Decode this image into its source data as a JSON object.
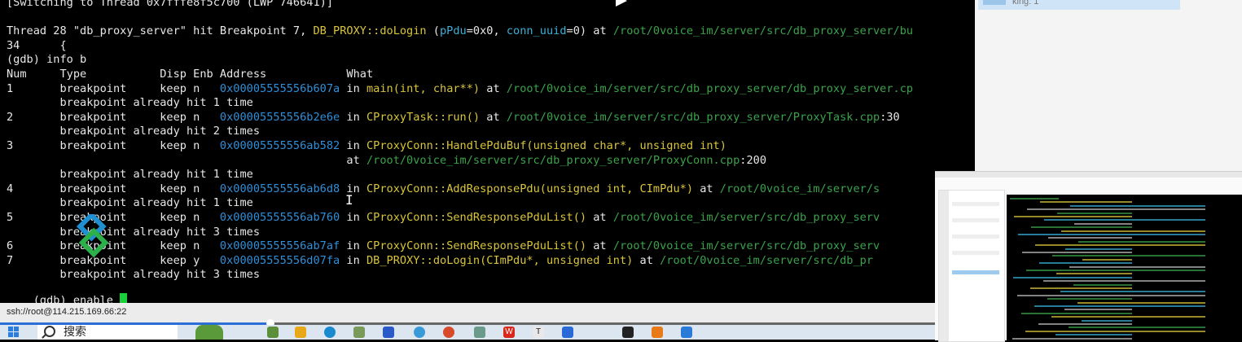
{
  "terminal": {
    "lines": [
      {
        "segments": [
          {
            "t": "[Switching to Thread 0x7fffe8f5c700 (LWP 746641)]",
            "c": ""
          }
        ]
      },
      {
        "segments": [
          {
            "t": "",
            "c": ""
          }
        ]
      },
      {
        "segments": [
          {
            "t": "Thread 28 \"db_proxy_server\" hit Breakpoint 7, ",
            "c": ""
          },
          {
            "t": "DB_PROXY::doLogin",
            "c": "y"
          },
          {
            "t": " (",
            "c": ""
          },
          {
            "t": "pPdu",
            "c": "c"
          },
          {
            "t": "=0x0, ",
            "c": ""
          },
          {
            "t": "conn_uuid",
            "c": "c"
          },
          {
            "t": "=0) at ",
            "c": ""
          },
          {
            "t": "/root/0voice_im/server/src/db_proxy_server/bu",
            "c": "g"
          }
        ]
      },
      {
        "segments": [
          {
            "t": "34      {",
            "c": ""
          }
        ]
      },
      {
        "segments": [
          {
            "t": "(gdb) info b",
            "c": ""
          }
        ]
      },
      {
        "segments": [
          {
            "t": "Num     Type           Disp Enb Address            What",
            "c": ""
          }
        ]
      },
      {
        "segments": [
          {
            "t": "1       breakpoint     keep n   ",
            "c": ""
          },
          {
            "t": "0x00005555556b607a",
            "c": "b"
          },
          {
            "t": " in ",
            "c": ""
          },
          {
            "t": "main(int, char**)",
            "c": "y"
          },
          {
            "t": " at ",
            "c": ""
          },
          {
            "t": "/root/0voice_im/server/src/db_proxy_server/db_proxy_server.cp",
            "c": "g"
          }
        ]
      },
      {
        "segments": [
          {
            "t": "        breakpoint already hit 1 time",
            "c": ""
          }
        ]
      },
      {
        "segments": [
          {
            "t": "2       breakpoint     keep n   ",
            "c": ""
          },
          {
            "t": "0x00005555556b2e6e",
            "c": "b"
          },
          {
            "t": " in ",
            "c": ""
          },
          {
            "t": "CProxyTask::run()",
            "c": "y"
          },
          {
            "t": " at ",
            "c": ""
          },
          {
            "t": "/root/0voice_im/server/src/db_proxy_server/ProxyTask.cpp",
            "c": "g"
          },
          {
            "t": ":30",
            "c": ""
          }
        ]
      },
      {
        "segments": [
          {
            "t": "        breakpoint already hit 2 times",
            "c": ""
          }
        ]
      },
      {
        "segments": [
          {
            "t": "3       breakpoint     keep n   ",
            "c": ""
          },
          {
            "t": "0x00005555556ab582",
            "c": "b"
          },
          {
            "t": " in ",
            "c": ""
          },
          {
            "t": "CProxyConn::HandlePduBuf(unsigned char*, unsigned int)",
            "c": "y"
          }
        ]
      },
      {
        "segments": [
          {
            "t": "                                                   at ",
            "c": ""
          },
          {
            "t": "/root/0voice_im/server/src/db_proxy_server/ProxyConn.cpp",
            "c": "g"
          },
          {
            "t": ":200",
            "c": ""
          }
        ]
      },
      {
        "segments": [
          {
            "t": "        breakpoint already hit 1 time",
            "c": ""
          }
        ]
      },
      {
        "segments": [
          {
            "t": "4       breakpoint     keep n   ",
            "c": ""
          },
          {
            "t": "0x00005555556ab6d8",
            "c": "b"
          },
          {
            "t": " in ",
            "c": ""
          },
          {
            "t": "CProxyConn::AddResponsePdu(unsigned int, CImPdu*)",
            "c": "y"
          },
          {
            "t": " at ",
            "c": ""
          },
          {
            "t": "/root/0voice_im/server/s",
            "c": "g"
          }
        ]
      },
      {
        "segments": [
          {
            "t": "        breakpoint already hit 1 time",
            "c": ""
          }
        ]
      },
      {
        "segments": [
          {
            "t": "5       breakpoint     keep n   ",
            "c": ""
          },
          {
            "t": "0x00005555556ab760",
            "c": "b"
          },
          {
            "t": " in ",
            "c": ""
          },
          {
            "t": "CProxyConn::SendResponsePduList()",
            "c": "y"
          },
          {
            "t": " at ",
            "c": ""
          },
          {
            "t": "/root/0voice_im/server/src/db_proxy_serv",
            "c": "g"
          }
        ]
      },
      {
        "segments": [
          {
            "t": "        breakpoint already hit 3 times",
            "c": ""
          }
        ]
      },
      {
        "segments": [
          {
            "t": "6       breakpoint     keep n   ",
            "c": ""
          },
          {
            "t": "0x00005555556ab7af",
            "c": "b"
          },
          {
            "t": " in ",
            "c": ""
          },
          {
            "t": "CProxyConn::SendResponsePduList()",
            "c": "y"
          },
          {
            "t": " at ",
            "c": ""
          },
          {
            "t": "/root/0voice_im/server/src/db_proxy_serv",
            "c": "g"
          }
        ]
      },
      {
        "segments": [
          {
            "t": "7       breakpoint     keep y   ",
            "c": ""
          },
          {
            "t": "0x00005555556d07fa",
            "c": "b"
          },
          {
            "t": " in ",
            "c": ""
          },
          {
            "t": "DB_PROXY::doLogin(CImPdu*, unsigned int)",
            "c": "y"
          },
          {
            "t": " at ",
            "c": ""
          },
          {
            "t": "/root/0voice_im/server/src/db_pr",
            "c": "g"
          }
        ]
      },
      {
        "segments": [
          {
            "t": "        breakpoint already hit 3 times",
            "c": ""
          }
        ]
      }
    ],
    "prompt": "(gdb) enable "
  },
  "right_panel": {
    "item_text": "king: 1"
  },
  "status": {
    "ssh": "ssh://root@114.215.169.66:22"
  },
  "playback_progress": 0.29,
  "taskbar": {
    "search_label": "搜索"
  },
  "colors": {
    "green": "#3aa34a",
    "yellow": "#d9c53a",
    "cyan": "#3bb0d7",
    "blue": "#2f8fd8",
    "cursor": "#19d03a"
  },
  "icons": [
    "play-icon",
    "windows-start-icon",
    "search-icon",
    "file-explorer-icon",
    "edge-icon",
    "wps-icon",
    "terminal-icon"
  ]
}
